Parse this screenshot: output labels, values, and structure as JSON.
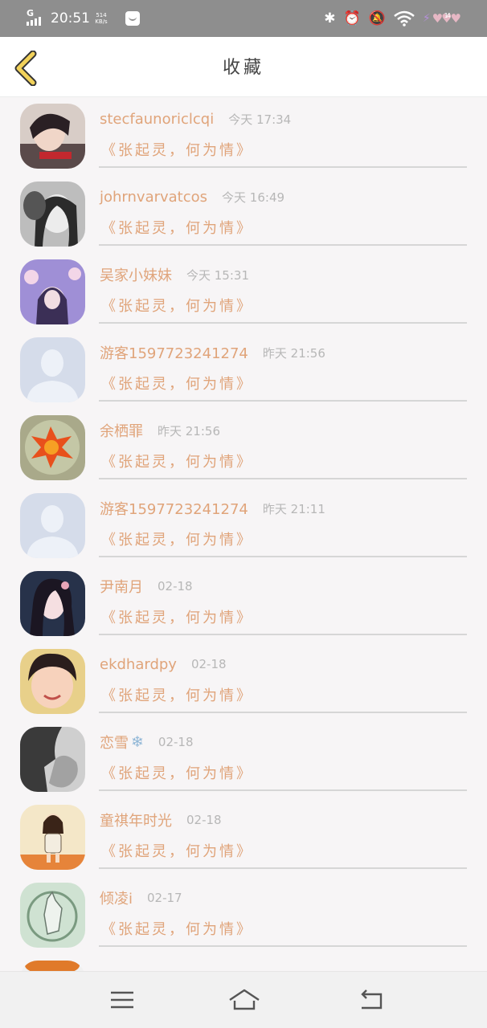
{
  "status_bar": {
    "network": "G",
    "time": "20:51",
    "speed": "514 KB/s",
    "battery": "14",
    "icons": [
      "message-icon",
      "bluetooth-icon",
      "alarm-icon",
      "mute-icon",
      "wifi-icon",
      "charging-icon"
    ]
  },
  "header": {
    "title": "收藏",
    "back_icon": "chevron-left-icon",
    "accent_color": "#f2d25a"
  },
  "colors": {
    "name_text": "#e0a47a",
    "time_text": "#b7b7b7",
    "separator": "#d6d6d6"
  },
  "items": [
    {
      "name": "stecfaunoriclcqi",
      "time": "今天 17:34",
      "collected": "《张起灵，何为情》",
      "avatar": "photo-boy"
    },
    {
      "name": "johrnvarvatcos",
      "time": "今天 16:49",
      "collected": "《张起灵，何为情》",
      "avatar": "photo-girl-bw"
    },
    {
      "name": "吴家小妹妹",
      "time": "今天 15:31",
      "collected": "《张起灵，何为情》",
      "avatar": "illustration-purple"
    },
    {
      "name": "游客15977232412​74",
      "time": "昨天 21:56",
      "collected": "《张起灵，何为情》",
      "avatar": "default"
    },
    {
      "name": "余栖罪",
      "time": "昨天 21:56",
      "collected": "《张起灵，何为情》",
      "avatar": "cactus-flower"
    },
    {
      "name": "游客15977232412​74",
      "time": "昨天 21:11",
      "collected": "《张起灵，何为情》",
      "avatar": "default"
    },
    {
      "name": "尹南月",
      "time": "02-18",
      "collected": "《张起灵，何为情》",
      "avatar": "photo-girl-dark"
    },
    {
      "name": "ekdhardpy",
      "time": "02-18",
      "collected": "《张起灵，何为情》",
      "avatar": "photo-girl-yellow"
    },
    {
      "name": "恋雪",
      "time": "02-18",
      "collected": "《张起灵，何为情》",
      "avatar": "photo-bw-profile",
      "name_emoji": "❄"
    },
    {
      "name": "童祺年时光",
      "time": "02-18",
      "collected": "《张起灵，何为情》",
      "avatar": "cartoon-girl"
    },
    {
      "name": "倾凌i",
      "time": "02-17",
      "collected": "《张起灵，何为情》",
      "avatar": "sketch-wolf"
    }
  ],
  "nav_bar": {
    "icons": [
      "menu-icon",
      "home-icon",
      "back-icon"
    ]
  }
}
